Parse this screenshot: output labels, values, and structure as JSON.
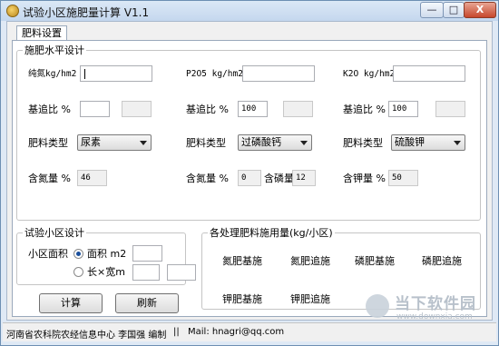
{
  "window": {
    "title": "试验小区施肥量计算 V1.1",
    "min_label": "—",
    "max_label": "□",
    "close_label": "X"
  },
  "tab": {
    "label": "肥料设置"
  },
  "fertilizer_level": {
    "legend": "施肥水平设计",
    "n": {
      "rate_label": "纯氮kg/hm2",
      "rate_value": "",
      "ratio_label": "基追比 %",
      "ratio_value": "",
      "ratio_readonly": "",
      "type_label": "肥料类型",
      "type_value": "尿素",
      "content_label": "含氮量 %",
      "content_value": "46"
    },
    "p": {
      "rate_label": "P2O5 kg/hm2",
      "rate_value": "",
      "ratio_label": "基追比 %",
      "ratio_value": "100",
      "ratio_readonly": "",
      "type_label": "肥料类型",
      "type_value": "过磷酸钙",
      "content_n_label": "含氮量 %",
      "content_n_value": "0",
      "content_p_label": "含磷量",
      "content_p_value": "12"
    },
    "k": {
      "rate_label": "K2O kg/hm2",
      "rate_value": "",
      "ratio_label": "基追比 %",
      "ratio_value": "100",
      "ratio_readonly": "",
      "type_label": "肥料类型",
      "type_value": "硫酸钾",
      "content_label": "含钾量 %",
      "content_value": "50"
    }
  },
  "plot_design": {
    "legend": "试验小区设计",
    "area_label": "小区面积",
    "option_area_label": "面积 m2",
    "option_area_value": "",
    "option_lw_label": "长×宽m",
    "length_value": "",
    "width_value": ""
  },
  "usage": {
    "legend": "各处理肥料施用量(kg/小区)",
    "n_base": "氮肥基施",
    "n_top": "氮肥追施",
    "p_base": "磷肥基施",
    "p_top": "磷肥追施",
    "k_base": "钾肥基施",
    "k_top": "钾肥追施"
  },
  "buttons": {
    "calc": "计算",
    "refresh": "刷新"
  },
  "status": {
    "author": "河南省农科院农经信息中心 李国强 编制",
    "sep": "||",
    "mail": "Mail: hnagri@qq.com"
  },
  "watermark": {
    "text": "当下软件园",
    "url": "www.downxia.com"
  }
}
